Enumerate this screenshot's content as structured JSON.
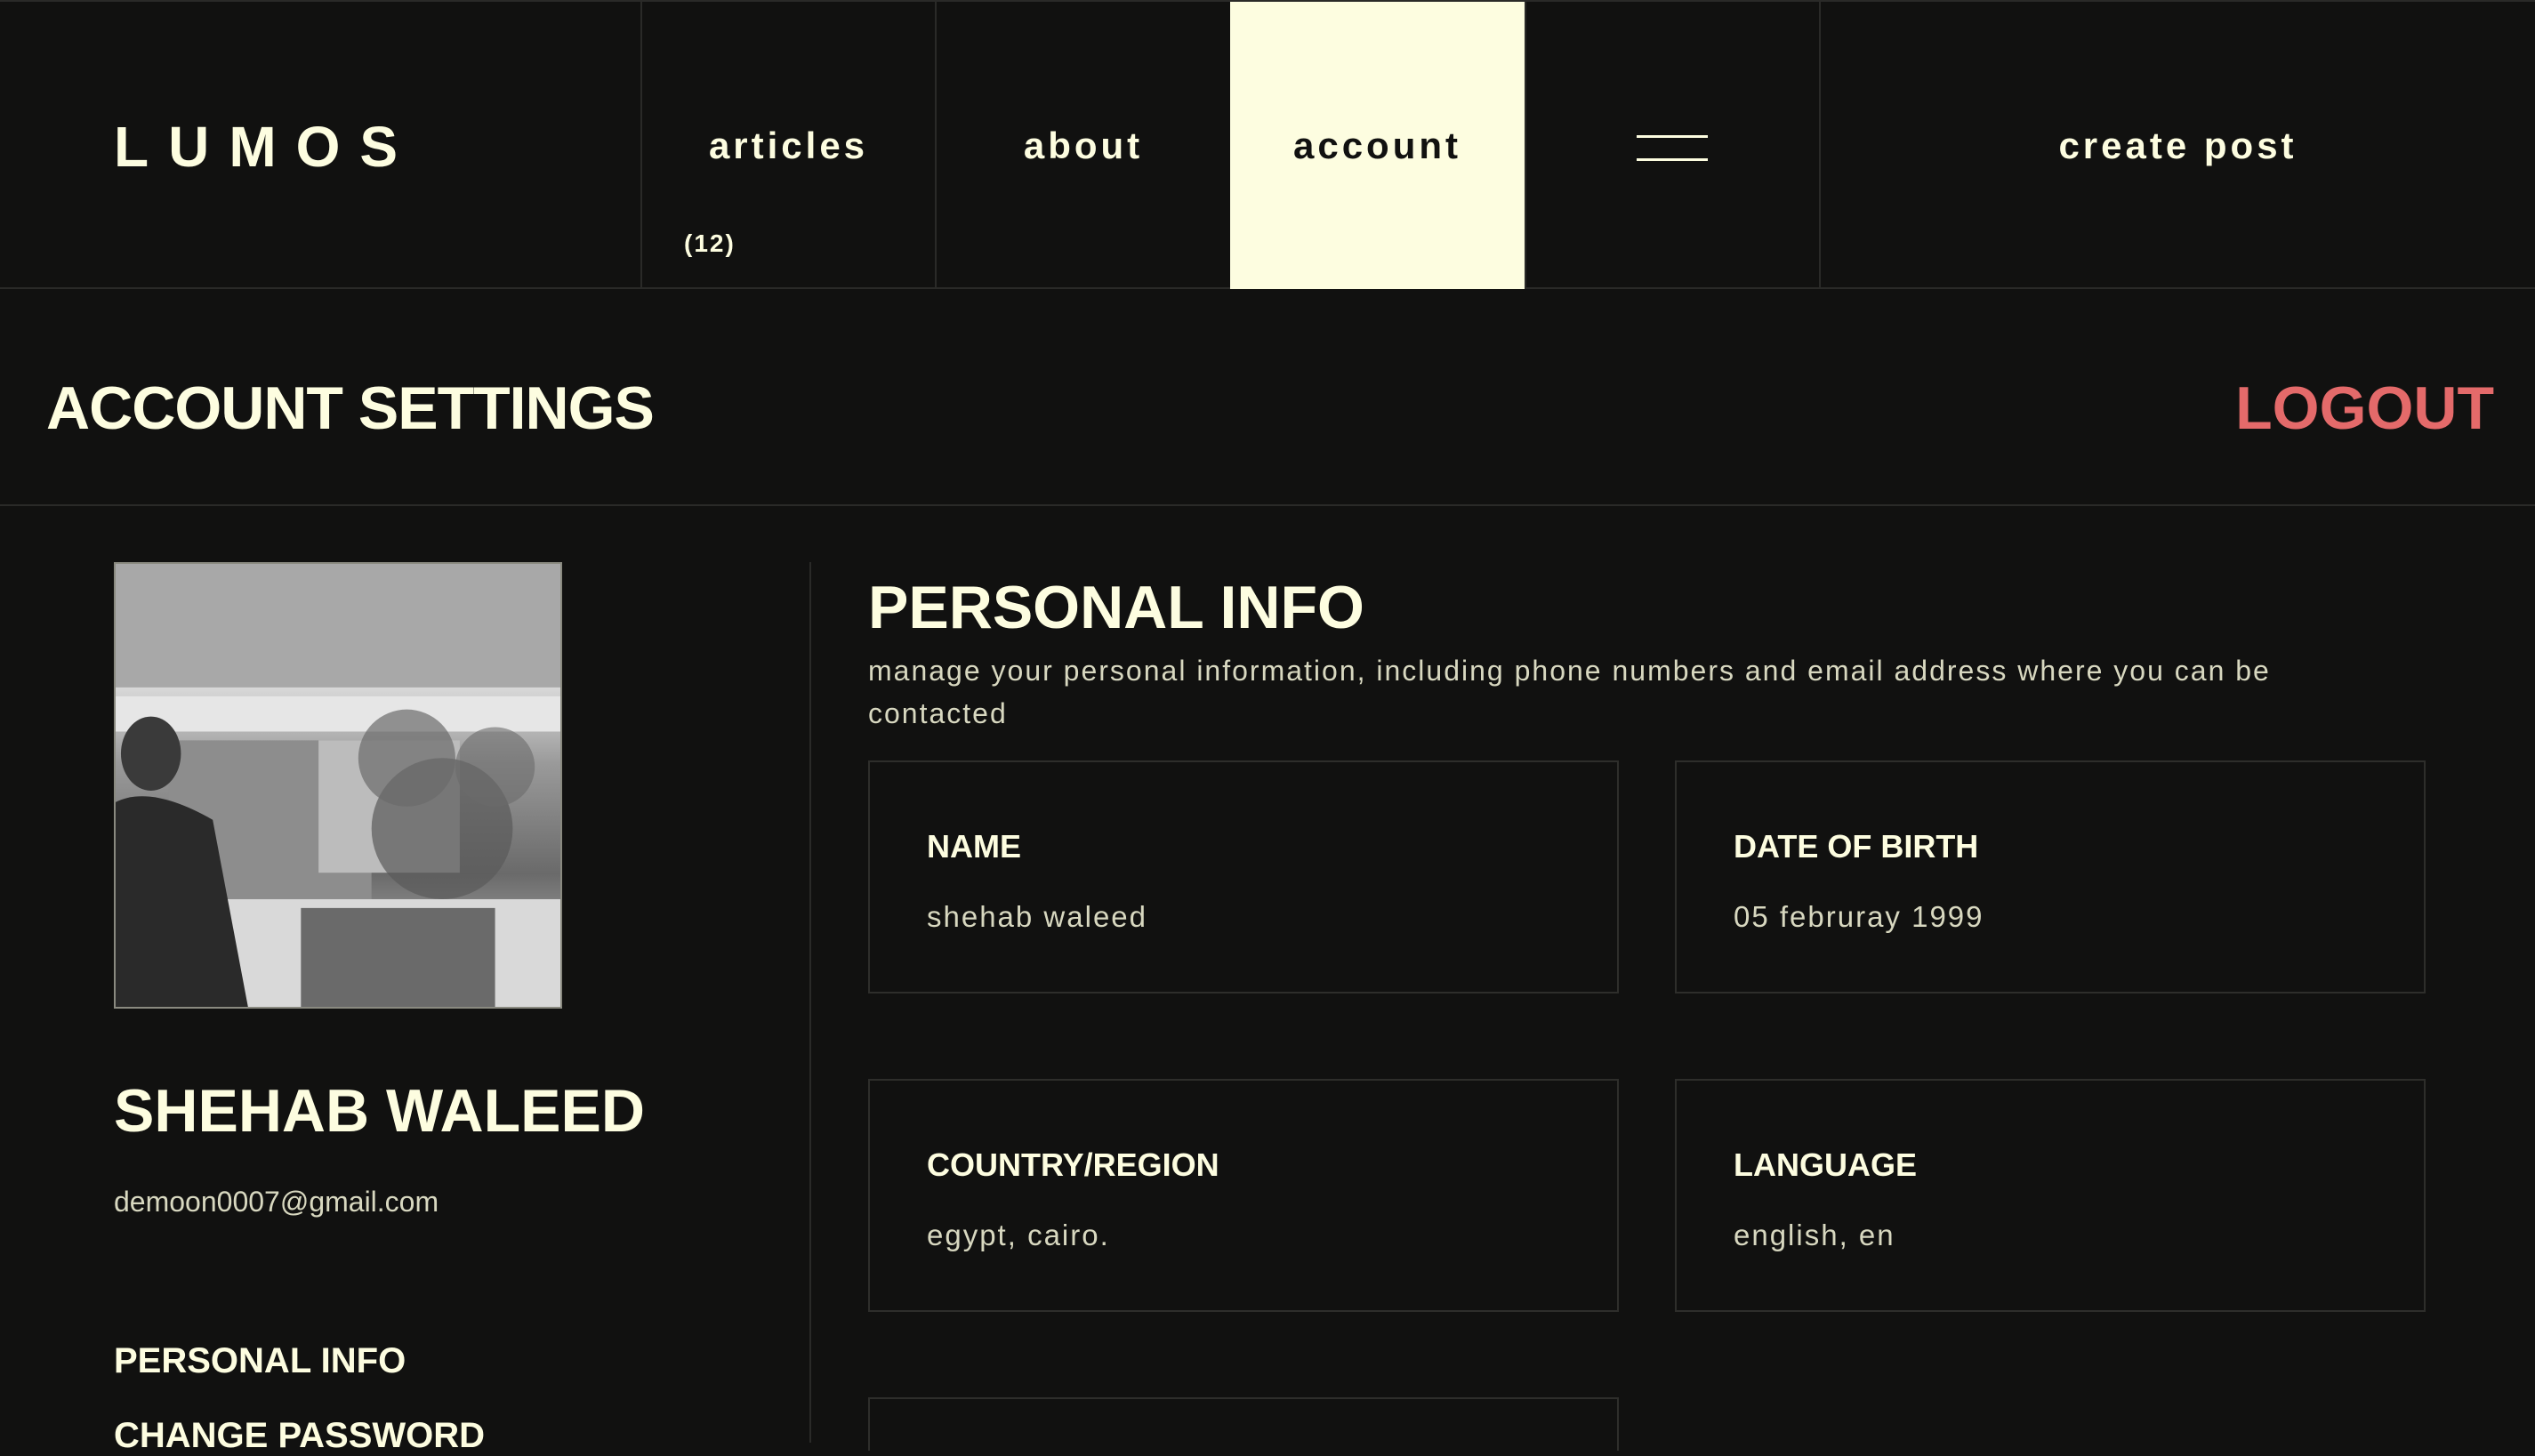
{
  "nav": {
    "logo": "LUMOS",
    "items": [
      {
        "label": "articles",
        "count": "(12)"
      },
      {
        "label": "about"
      },
      {
        "label": "account",
        "active": true
      },
      {
        "label": "create post"
      }
    ],
    "menu_icon": "hamburger-icon"
  },
  "header": {
    "title": "ACCOUNT SETTINGS",
    "logout_label": "LOGOUT",
    "logout_color": "#e46a6a"
  },
  "profile": {
    "name": "SHEHAB WALEED",
    "email": "demoon0007@gmail.com",
    "links": [
      "PERSONAL INFO",
      "CHANGE PASSWORD"
    ]
  },
  "personal_info": {
    "title": "PERSONAL INFO",
    "description": "manage your personal information, including phone numbers and email address where you can be contacted",
    "fields": [
      {
        "label": "NAME",
        "value": "shehab waleed"
      },
      {
        "label": "DATE OF BIRTH",
        "value": "05 februray 1999"
      },
      {
        "label": "COUNTRY/REGION",
        "value": "egypt, cairo."
      },
      {
        "label": "LANGUAGE",
        "value": "english, en"
      }
    ]
  },
  "colors": {
    "background": "#111110",
    "accent": "#fdfde0",
    "danger": "#e46a6a"
  }
}
